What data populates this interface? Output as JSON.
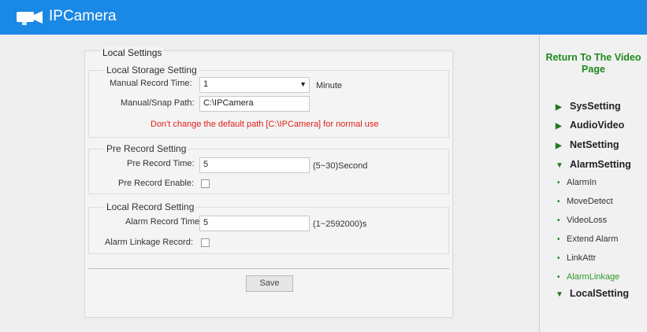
{
  "app": {
    "title": "IPCamera"
  },
  "sidebar": {
    "return_link": "Return To The Video Page",
    "items": [
      {
        "label": "SysSetting",
        "marker": "▶"
      },
      {
        "label": "AudioVideo",
        "marker": "▶"
      },
      {
        "label": "NetSetting",
        "marker": "▶"
      },
      {
        "label": "AlarmSetting",
        "marker": "▼"
      },
      {
        "label": "LocalSetting",
        "marker": "▼"
      }
    ],
    "alarm_subitems": [
      {
        "label": "AlarmIn"
      },
      {
        "label": "MoveDetect"
      },
      {
        "label": "VideoLoss"
      },
      {
        "label": "Extend Alarm"
      },
      {
        "label": "LinkAttr"
      },
      {
        "label": "AlarmLinkage",
        "active": true
      }
    ],
    "bullet": "•"
  },
  "panel": {
    "title": "Local Settings",
    "storage": {
      "title": "Local Storage Setting",
      "record_time_label": "Manual Record Time:",
      "record_time_value": "1",
      "record_time_unit": "Minute",
      "path_label": "Manual/Snap Path:",
      "path_value": "C:\\IPCamera",
      "warning": "Don't change the default path [C:\\IPCamera] for normal use"
    },
    "pre_record": {
      "title": "Pre Record Setting",
      "time_label": "Pre Record Time:",
      "time_value": "5",
      "time_unit": "(5~30)Second",
      "enable_label": "Pre Record Enable:",
      "enable_checked": false
    },
    "local_record": {
      "title": "Local Record Setting",
      "alarm_time_label": "Alarm Record Time:",
      "alarm_time_value": "5",
      "alarm_time_unit": "(1~2592000)s",
      "linkage_label": "Alarm Linkage Record:",
      "linkage_checked": false
    },
    "save_label": "Save"
  },
  "colors": {
    "header": "#1a88e5",
    "warning": "#e0201a",
    "link": "#1e8a1e"
  }
}
